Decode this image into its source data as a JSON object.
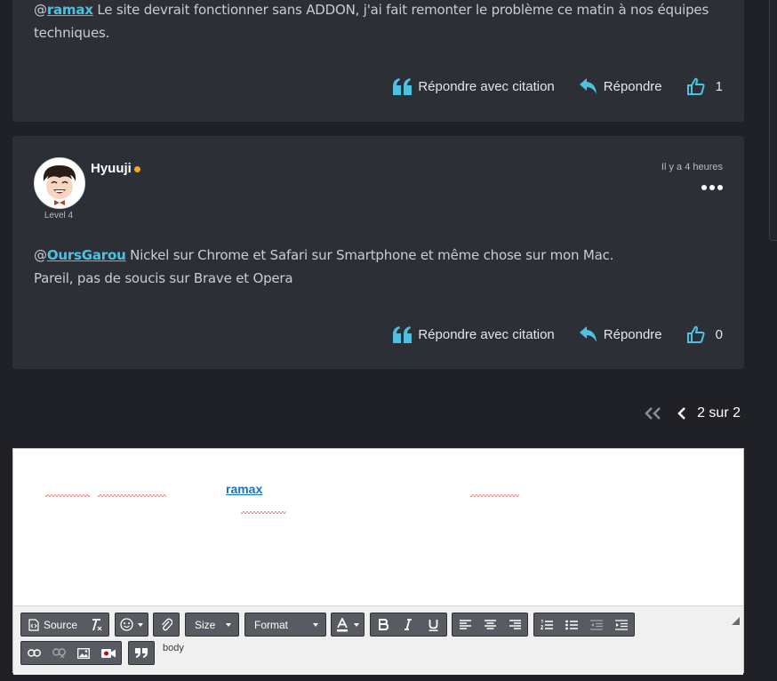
{
  "posts": [
    {
      "mention": "ramax",
      "text_lines": [
        "Le site devrait fonctionner sans ADDON, j'ai fait remonter le problème ce matin à nos équipes",
        "techniques."
      ],
      "actions": {
        "quote": "Répondre avec citation",
        "reply": "Répondre",
        "likes": "1"
      }
    },
    {
      "author": "Hyuuji",
      "level": "Level 4",
      "timestamp": "Il y a 4 heures",
      "mention": "OursGarou",
      "text_line1": "Nickel sur Chrome et Safari sur Smartphone et même chose sur mon Mac.",
      "text_line2": "Pareil, pas de soucis sur Brave et Opera",
      "actions": {
        "quote": "Répondre avec citation",
        "reply": "Répondre",
        "likes": "0"
      }
    }
  ],
  "pagination": {
    "label": "2 sur 2"
  },
  "editor": {
    "mention": "ramax",
    "path": "body",
    "toolbar": {
      "source": "Source",
      "size": "Size",
      "format": "Format"
    }
  },
  "colors": {
    "accent": "#4fc1e0",
    "background": "#1f2126",
    "card": "#2c2f36",
    "online": "#f5a623"
  }
}
